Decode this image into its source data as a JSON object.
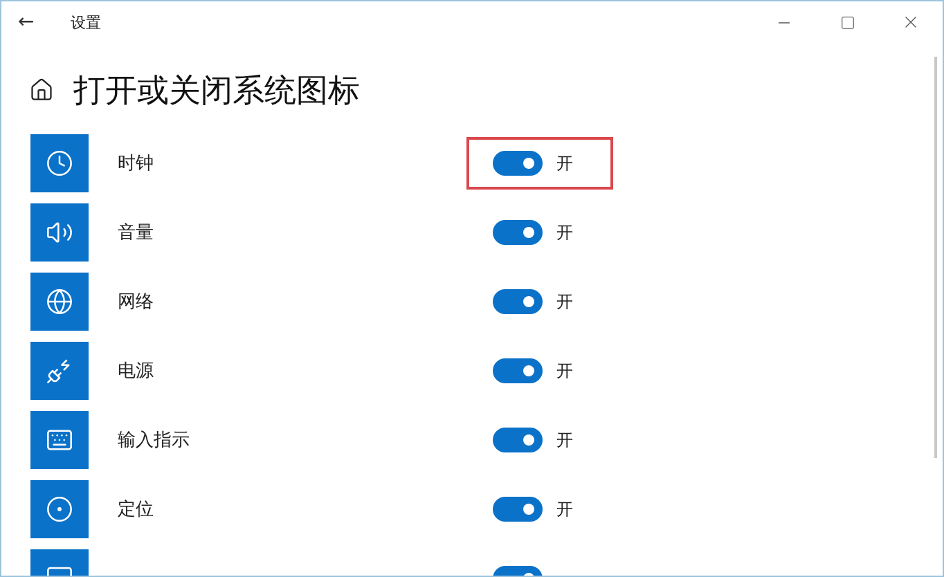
{
  "window": {
    "title": "设置",
    "back": "←"
  },
  "page": {
    "title": "打开或关闭系统图标"
  },
  "items": [
    {
      "kind": "clock",
      "label": "时钟",
      "on": true,
      "state_label": "开",
      "highlighted": true
    },
    {
      "kind": "volume",
      "label": "音量",
      "on": true,
      "state_label": "开",
      "highlighted": false
    },
    {
      "kind": "network",
      "label": "网络",
      "on": true,
      "state_label": "开",
      "highlighted": false
    },
    {
      "kind": "power",
      "label": "电源",
      "on": true,
      "state_label": "开",
      "highlighted": false
    },
    {
      "kind": "input",
      "label": "输入指示",
      "on": true,
      "state_label": "开",
      "highlighted": false
    },
    {
      "kind": "location",
      "label": "定位",
      "on": true,
      "state_label": "开",
      "highlighted": false
    },
    {
      "kind": "action",
      "on": true,
      "highlighted": false
    }
  ]
}
